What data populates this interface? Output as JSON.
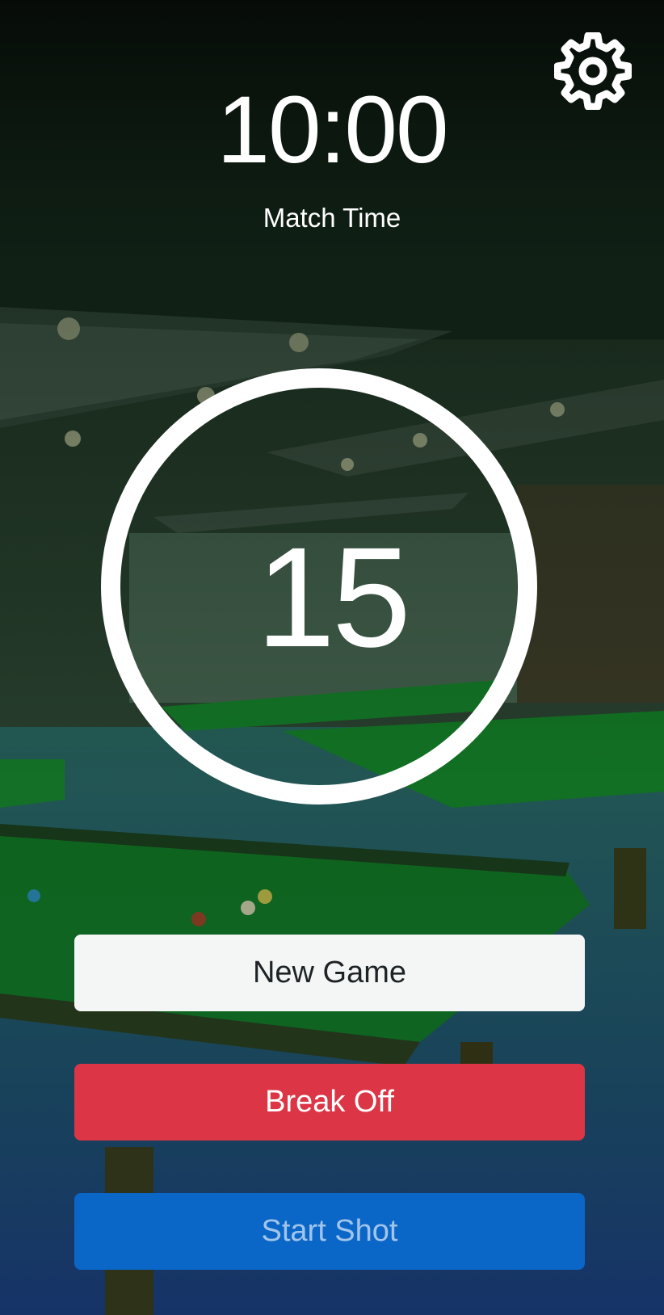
{
  "match": {
    "time": "10:00",
    "label": "Match Time"
  },
  "shot_clock": {
    "value": "15"
  },
  "buttons": {
    "new_game": "New Game",
    "break_off": "Break Off",
    "start_shot": "Start Shot"
  },
  "icons": {
    "settings": "gear-icon"
  },
  "colors": {
    "new_game_bg": "#f4f6f6",
    "break_off_bg": "#dc3546",
    "start_shot_bg": "#0a66c7",
    "clock_ring": "#ffffff"
  }
}
